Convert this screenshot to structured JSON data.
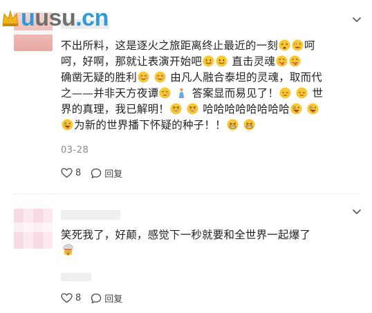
{
  "watermark": {
    "text_parts": [
      "u",
      "usu",
      ".cn"
    ],
    "text": "uusu.cn"
  },
  "comments": [
    {
      "lines": [
        "不出所料，这是逐火之旅距离终止最近的一刻",
        "呵",
        "呵，好啊，那就让表演开始吧",
        "直击灵魂",
        "确凿无疑的胜利",
        "由凡人融合泰坦的灵魂，取而代",
        "之——并非天方夜谭",
        "答案显而易见了！",
        "世",
        "界的真理，我已解明！",
        "哈哈哈哈哈哈哈哈",
        "为新的世界播下怀疑的种子！！"
      ],
      "date": "03-28",
      "likes": "8",
      "reply_label": "回复"
    },
    {
      "lines": [
        "笑死我了，好颠，感觉下一秒就要和全世界一起爆了"
      ],
      "likes": "8",
      "reply_label": "回复"
    }
  ],
  "icons": {
    "like": "heart-outline-icon",
    "reply": "speech-bubble-icon",
    "more": "chevron-down-icon",
    "emoji_kinds": [
      "dizzy-face",
      "zany-face",
      "smiling-face",
      "blushing-face",
      "shushing-face",
      "praying-person",
      "pensive-face",
      "grinning-squint-face",
      "tongue-face",
      "grimacing-face",
      "exploding-head"
    ]
  },
  "colors": {
    "logo_blue": "#2d9bd8",
    "logo_gray": "#6f6f6f",
    "emoji_yellow": "#f9c634",
    "text": "#222222",
    "muted": "#888888"
  }
}
